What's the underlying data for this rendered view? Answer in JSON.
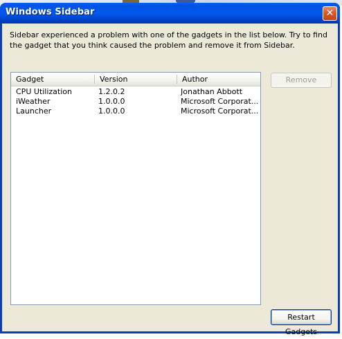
{
  "window": {
    "title": "Windows Sidebar",
    "close_glyph": "✕"
  },
  "message": "Sidebar experienced a problem with one of the gadgets in the list below. Try to find the gadget that you think caused the problem and remove it from Sidebar.",
  "gadget_list": {
    "columns": [
      "Gadget",
      "Version",
      "Author"
    ],
    "rows": [
      {
        "gadget": "CPU Utilization",
        "version": "1.2.0.2",
        "author": "Jonathan Abbott"
      },
      {
        "gadget": "iWeather",
        "version": "1.0.0.0",
        "author": "Microsoft Corporat..."
      },
      {
        "gadget": "Launcher",
        "version": "1.0.0.0",
        "author": "Microsoft Corporat..."
      }
    ]
  },
  "buttons": {
    "remove": "Remove",
    "restart": "Restart Gadgets"
  },
  "colors": {
    "titlebar": "#0054e3",
    "client_bg": "#ece9d8",
    "close_button": "#d65a2b"
  }
}
